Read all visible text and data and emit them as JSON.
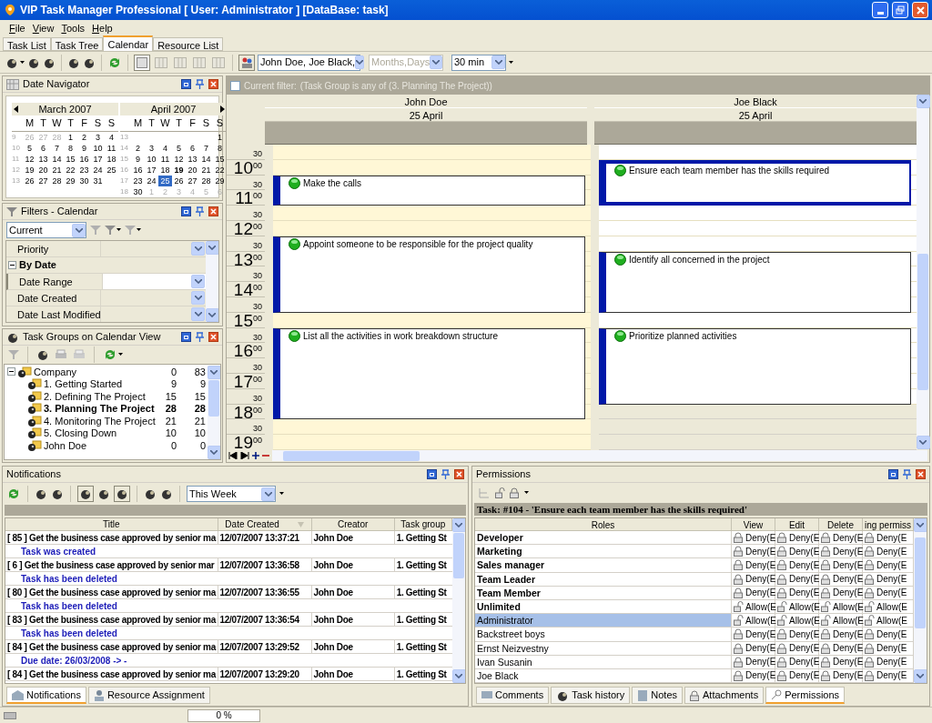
{
  "window": {
    "title": "VIP Task Manager Professional [ User: Administrator ] [DataBase: task]"
  },
  "menu": [
    "File",
    "View",
    "Tools",
    "Help"
  ],
  "tabs": [
    {
      "label": "Task List",
      "selected": false
    },
    {
      "label": "Task Tree",
      "selected": false
    },
    {
      "label": "Calendar",
      "selected": true
    },
    {
      "label": "Resource List",
      "selected": false
    }
  ],
  "toolbar": {
    "resources": "John Doe, Joe Black,",
    "scale": {
      "value": "Months,Days",
      "disabled": true
    },
    "interval": {
      "value": "30 min",
      "disabled": false
    }
  },
  "date_navigator": {
    "title": "Date Navigator",
    "months": [
      {
        "title": "March 2007",
        "days_of_week": [
          "M",
          "T",
          "W",
          "T",
          "F",
          "S",
          "S"
        ],
        "weeks": [
          {
            "number": "9",
            "days": [
              {
                "day": "26",
                "kind": "other",
                "selected": false
              },
              {
                "day": "27",
                "kind": "other",
                "selected": false
              },
              {
                "day": "28",
                "kind": "other",
                "selected": false
              },
              {
                "day": "1",
                "kind": "day",
                "selected": false
              },
              {
                "day": "2",
                "kind": "day",
                "selected": false
              },
              {
                "day": "3",
                "kind": "day",
                "selected": false
              },
              {
                "day": "4",
                "kind": "day",
                "selected": false
              }
            ]
          },
          {
            "number": "10",
            "days": [
              {
                "day": "5",
                "kind": "day",
                "selected": false
              },
              {
                "day": "6",
                "kind": "day",
                "selected": false
              },
              {
                "day": "7",
                "kind": "day",
                "selected": false
              },
              {
                "day": "8",
                "kind": "day",
                "selected": false
              },
              {
                "day": "9",
                "kind": "day",
                "selected": false
              },
              {
                "day": "10",
                "kind": "day",
                "selected": false
              },
              {
                "day": "11",
                "kind": "day",
                "selected": false
              }
            ]
          },
          {
            "number": "11",
            "days": [
              {
                "day": "12",
                "kind": "day",
                "selected": false
              },
              {
                "day": "13",
                "kind": "day",
                "selected": false
              },
              {
                "day": "14",
                "kind": "day",
                "selected": false
              },
              {
                "day": "15",
                "kind": "day",
                "selected": false
              },
              {
                "day": "16",
                "kind": "day",
                "selected": false
              },
              {
                "day": "17",
                "kind": "day",
                "selected": false
              },
              {
                "day": "18",
                "kind": "day",
                "selected": false
              }
            ]
          },
          {
            "number": "12",
            "days": [
              {
                "day": "19",
                "kind": "day",
                "selected": false
              },
              {
                "day": "20",
                "kind": "day",
                "selected": false
              },
              {
                "day": "21",
                "kind": "day",
                "selected": false
              },
              {
                "day": "22",
                "kind": "day",
                "selected": false
              },
              {
                "day": "23",
                "kind": "day",
                "selected": false
              },
              {
                "day": "24",
                "kind": "day",
                "selected": false
              },
              {
                "day": "25",
                "kind": "day",
                "selected": false
              }
            ]
          },
          {
            "number": "13",
            "days": [
              {
                "day": "26",
                "kind": "day",
                "selected": false
              },
              {
                "day": "27",
                "kind": "day",
                "selected": false
              },
              {
                "day": "28",
                "kind": "day",
                "selected": false
              },
              {
                "day": "29",
                "kind": "day",
                "selected": false
              },
              {
                "day": "30",
                "kind": "day",
                "selected": false
              },
              {
                "day": "31",
                "kind": "day",
                "selected": false
              }
            ]
          }
        ]
      },
      {
        "title": "April 2007",
        "days_of_week": [
          "M",
          "T",
          "W",
          "T",
          "F",
          "S",
          "S"
        ],
        "weeks": [
          {
            "number": "13",
            "days": [
              {
                "kind": "blank"
              },
              {
                "kind": "blank"
              },
              {
                "kind": "blank"
              },
              {
                "kind": "blank"
              },
              {
                "kind": "blank"
              },
              {
                "kind": "blank"
              },
              {
                "day": "1",
                "kind": "day",
                "selected": false
              }
            ]
          },
          {
            "number": "14",
            "days": [
              {
                "day": "2",
                "kind": "day",
                "selected": false
              },
              {
                "day": "3",
                "kind": "day",
                "selected": false
              },
              {
                "day": "4",
                "kind": "day",
                "selected": false
              },
              {
                "day": "5",
                "kind": "day",
                "selected": false
              },
              {
                "day": "6",
                "kind": "day",
                "selected": false
              },
              {
                "day": "7",
                "kind": "day",
                "selected": false
              },
              {
                "day": "8",
                "kind": "day",
                "selected": false
              }
            ]
          },
          {
            "number": "15",
            "days": [
              {
                "day": "9",
                "kind": "day",
                "selected": false
              },
              {
                "day": "10",
                "kind": "day",
                "selected": false
              },
              {
                "day": "11",
                "kind": "day",
                "selected": false
              },
              {
                "day": "12",
                "kind": "day",
                "selected": false
              },
              {
                "day": "13",
                "kind": "day",
                "selected": false
              },
              {
                "day": "14",
                "kind": "day",
                "selected": false
              },
              {
                "day": "15",
                "kind": "day",
                "selected": false
              }
            ]
          },
          {
            "number": "16",
            "days": [
              {
                "day": "16",
                "kind": "day",
                "selected": false
              },
              {
                "day": "17",
                "kind": "day",
                "selected": false
              },
              {
                "day": "18",
                "kind": "day",
                "selected": false
              },
              {
                "day": "19",
                "kind": "today",
                "selected": false
              },
              {
                "day": "20",
                "kind": "day",
                "selected": false
              },
              {
                "day": "21",
                "kind": "day",
                "selected": false
              },
              {
                "day": "22",
                "kind": "day",
                "selected": false
              }
            ]
          },
          {
            "number": "17",
            "days": [
              {
                "day": "23",
                "kind": "day",
                "selected": false
              },
              {
                "day": "24",
                "kind": "day",
                "selected": false
              },
              {
                "day": "25",
                "kind": "day",
                "selected": true
              },
              {
                "day": "26",
                "kind": "day",
                "selected": false
              },
              {
                "day": "27",
                "kind": "day",
                "selected": false
              },
              {
                "day": "28",
                "kind": "day",
                "selected": false
              },
              {
                "day": "29",
                "kind": "day",
                "selected": false
              }
            ]
          },
          {
            "number": "18",
            "days": [
              {
                "day": "30",
                "kind": "day",
                "selected": false
              },
              {
                "day": "1",
                "kind": "other",
                "selected": false
              },
              {
                "day": "2",
                "kind": "other",
                "selected": false
              },
              {
                "day": "3",
                "kind": "other",
                "selected": false
              },
              {
                "day": "4",
                "kind": "other",
                "selected": false
              },
              {
                "day": "5",
                "kind": "other",
                "selected": false
              },
              {
                "day": "6",
                "kind": "other",
                "selected": false
              }
            ]
          }
        ]
      }
    ]
  },
  "filters": {
    "title": "Filters - Calendar",
    "preset": "Current",
    "rows": [
      {
        "kind": "field",
        "label": "Priority",
        "selected": false
      },
      {
        "kind": "category",
        "label": "By Date",
        "expanded": true
      },
      {
        "kind": "field",
        "label": "Date Range",
        "selected": true
      },
      {
        "kind": "field",
        "label": "Date Created",
        "selected": false
      },
      {
        "kind": "field",
        "label": "Date Last Modified",
        "selected": false
      }
    ]
  },
  "task_groups": {
    "title": "Task Groups on Calendar View",
    "tree": [
      {
        "label": "Company",
        "count_1": "0",
        "count_2": "83",
        "selected": false,
        "expanded": true,
        "children": [
          {
            "label": "1. Getting Started",
            "count_1": "9",
            "count_2": "9",
            "selected": false
          },
          {
            "label": "2. Defining The Project",
            "count_1": "15",
            "count_2": "15",
            "selected": false
          },
          {
            "label": "3. Planning The Project",
            "count_1": "28",
            "count_2": "28",
            "selected": true
          },
          {
            "label": "4. Monitoring The Project",
            "count_1": "21",
            "count_2": "21",
            "selected": false
          },
          {
            "label": "5. Closing Down",
            "count_1": "10",
            "count_2": "10",
            "selected": false
          },
          {
            "label": "John Doe",
            "count_1": "0",
            "count_2": "0",
            "selected": false
          }
        ]
      }
    ]
  },
  "calendar": {
    "filter": {
      "checked": false,
      "label": "Current filter:",
      "value": "(Task Group is any of (3. Planning The Project))"
    },
    "time_slots": [
      {
        "minute": "30"
      },
      {
        "hour": "10",
        "minute": "00"
      },
      {
        "minute": "30"
      },
      {
        "hour": "11",
        "minute": "00"
      },
      {
        "minute": "30"
      },
      {
        "hour": "12",
        "minute": "00"
      },
      {
        "minute": "30"
      },
      {
        "hour": "13",
        "minute": "00"
      },
      {
        "minute": "30"
      },
      {
        "hour": "14",
        "minute": "00"
      },
      {
        "minute": "30"
      },
      {
        "hour": "15",
        "minute": "00"
      },
      {
        "minute": "30"
      },
      {
        "hour": "16",
        "minute": "00"
      },
      {
        "minute": "30"
      },
      {
        "hour": "17",
        "minute": "00"
      },
      {
        "minute": "30"
      },
      {
        "hour": "18",
        "minute": "00"
      },
      {
        "minute": "30"
      },
      {
        "hour": "19",
        "minute": "00"
      }
    ],
    "columns": [
      {
        "resource": "John Doe",
        "date": "25 April",
        "color": "#fff7d6",
        "slots": [
          {
            "kind": "free"
          },
          {
            "kind": "free"
          },
          {
            "kind": "start"
          },
          {
            "kind": "body"
          },
          {
            "kind": "free"
          },
          {
            "kind": "free"
          },
          {
            "kind": "start"
          },
          {
            "kind": "body"
          },
          {
            "kind": "body"
          },
          {
            "kind": "body"
          },
          {
            "kind": "body"
          },
          {
            "kind": "free"
          },
          {
            "kind": "start"
          },
          {
            "kind": "body"
          },
          {
            "kind": "body"
          },
          {
            "kind": "body"
          },
          {
            "kind": "body"
          },
          {
            "kind": "body"
          },
          {
            "kind": "free"
          },
          {
            "kind": "free"
          }
        ],
        "events": [
          {
            "title": "Make the calls",
            "selected": false
          },
          {
            "title": "Appoint someone to be responsible for the project quality",
            "selected": false
          },
          {
            "title": "List all the activities in work breakdown structure",
            "selected": false
          }
        ]
      },
      {
        "resource": "Joe Black",
        "date": "25 April",
        "color": "#ffffff",
        "slots": [
          {
            "kind": "free"
          },
          {
            "kind": "start"
          },
          {
            "kind": "body"
          },
          {
            "kind": "body"
          },
          {
            "kind": "free"
          },
          {
            "kind": "free"
          },
          {
            "kind": "free"
          },
          {
            "kind": "start"
          },
          {
            "kind": "body"
          },
          {
            "kind": "body"
          },
          {
            "kind": "body"
          },
          {
            "kind": "free"
          },
          {
            "kind": "start"
          },
          {
            "kind": "body"
          },
          {
            "kind": "body"
          },
          {
            "kind": "body"
          },
          {
            "kind": "body"
          },
          {
            "kind": "off"
          },
          {
            "kind": "off"
          },
          {
            "kind": "off"
          }
        ],
        "events": [
          {
            "title": "Ensure each team member has the skills required",
            "selected": true
          },
          {
            "title": "Identify all concerned in the project",
            "selected": false
          },
          {
            "title": "Prioritize planned activities",
            "selected": false
          }
        ]
      }
    ]
  },
  "notifications": {
    "title": "Notifications",
    "period": "This Week",
    "columns": [
      "Title",
      "Date Created",
      "Creator",
      "Task group"
    ],
    "rows": [
      {
        "title": "[ 85 ] Get the business case approved by senior ma",
        "date": "12/07/2007 13:37:21",
        "creator": "John Doe",
        "group": "1. Getting St",
        "detail": "Task was created"
      },
      {
        "title": "[ 6 ] Get the business case approved by senior mar",
        "date": "12/07/2007 13:36:58",
        "creator": "John Doe",
        "group": "1. Getting St",
        "detail": "Task has been deleted"
      },
      {
        "title": "[ 80 ] Get the business case approved by senior ma",
        "date": "12/07/2007 13:36:55",
        "creator": "John Doe",
        "group": "1. Getting St",
        "detail": "Task has been deleted"
      },
      {
        "title": "[ 83 ] Get the business case approved by senior ma",
        "date": "12/07/2007 13:36:54",
        "creator": "John Doe",
        "group": "1. Getting St",
        "detail": "Task has been deleted"
      },
      {
        "title": "[ 84 ] Get the business case approved by senior ma",
        "date": "12/07/2007 13:29:52",
        "creator": "John Doe",
        "group": "1. Getting St",
        "detail": "Due date: 26/03/2008 -> -"
      },
      {
        "title": "[ 84 ] Get the business case approved by senior ma",
        "date": "12/07/2007 13:29:20",
        "creator": "John Doe",
        "group": "1. Getting St"
      }
    ],
    "tabs": [
      {
        "label": "Notifications",
        "selected": true
      },
      {
        "label": "Resource Assignment",
        "selected": false
      }
    ]
  },
  "permissions": {
    "title": "Permissions",
    "task": "Task: #104 - 'Ensure each team member has the skills required'",
    "role_column": "Roles",
    "columns": [
      "View",
      "Edit",
      "Delete",
      "ing permiss"
    ],
    "rows": [
      {
        "role": "Developer",
        "kind": "group",
        "allowed": false,
        "selected": false,
        "cells": [
          "Deny(E",
          "Deny(E",
          "Deny(E",
          "Deny(E"
        ]
      },
      {
        "role": "Marketing",
        "kind": "group",
        "allowed": false,
        "selected": false,
        "cells": [
          "Deny(E",
          "Deny(E",
          "Deny(E",
          "Deny(E"
        ]
      },
      {
        "role": "Sales manager",
        "kind": "group",
        "allowed": false,
        "selected": false,
        "cells": [
          "Deny(E",
          "Deny(E",
          "Deny(E",
          "Deny(E"
        ]
      },
      {
        "role": "Team Leader",
        "kind": "group",
        "allowed": false,
        "selected": false,
        "cells": [
          "Deny(E",
          "Deny(E",
          "Deny(E",
          "Deny(E"
        ]
      },
      {
        "role": "Team Member",
        "kind": "group",
        "allowed": false,
        "selected": false,
        "cells": [
          "Deny(E",
          "Deny(E",
          "Deny(E",
          "Deny(E"
        ]
      },
      {
        "role": "Unlimited",
        "kind": "group",
        "allowed": true,
        "selected": false,
        "cells": [
          "Allow(E",
          "Allow(E",
          "Allow(E",
          "Allow(E"
        ]
      },
      {
        "role": "Administrator",
        "kind": "user",
        "allowed": true,
        "selected": true,
        "cells": [
          "Allow(E",
          "Allow(E",
          "Allow(E",
          "Allow(E"
        ]
      },
      {
        "role": "Backstreet boys",
        "kind": "user",
        "allowed": false,
        "selected": false,
        "cells": [
          "Deny(E",
          "Deny(E",
          "Deny(E",
          "Deny(E"
        ]
      },
      {
        "role": "Ernst Neizvestny",
        "kind": "user",
        "allowed": false,
        "selected": false,
        "cells": [
          "Deny(E",
          "Deny(E",
          "Deny(E",
          "Deny(E"
        ]
      },
      {
        "role": "Ivan Susanin",
        "kind": "user",
        "allowed": false,
        "selected": false,
        "cells": [
          "Deny(E",
          "Deny(E",
          "Deny(E",
          "Deny(E"
        ]
      },
      {
        "role": "Joe Black",
        "kind": "user",
        "allowed": false,
        "selected": false,
        "cells": [
          "Deny(E",
          "Deny(E",
          "Deny(E",
          "Deny(E"
        ]
      }
    ],
    "tabs": [
      {
        "label": "Comments",
        "selected": false
      },
      {
        "label": "Task history",
        "selected": false
      },
      {
        "label": "Notes",
        "selected": false
      },
      {
        "label": "Attachments",
        "selected": false
      },
      {
        "label": "Permissions",
        "selected": true
      }
    ]
  },
  "status_bar": {
    "progress": "0 %"
  }
}
